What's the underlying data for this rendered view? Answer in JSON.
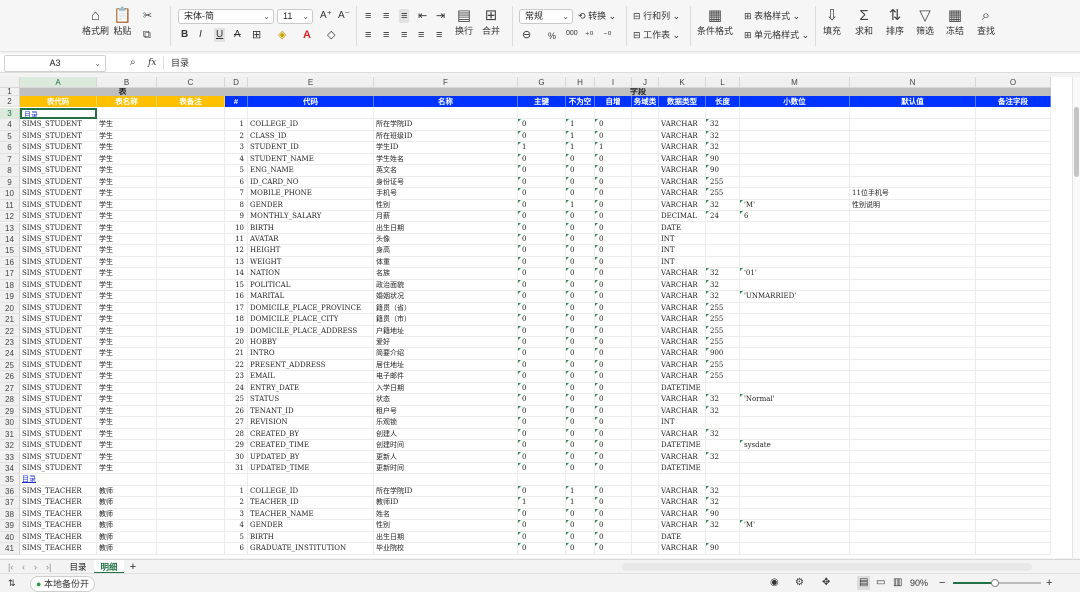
{
  "toolbar": {
    "format_painter": "格式刷",
    "paste": "粘贴",
    "font_name": "宋体-简",
    "font_size": "11",
    "wrap": "换行",
    "merge": "合并",
    "number_format": "常规",
    "convert": "转换",
    "rows_cols": "行和列",
    "worksheet": "工作表",
    "cond_format": "条件格式",
    "table_style": "表格样式",
    "cell_style": "单元格样式",
    "fill": "填充",
    "sum": "求和",
    "sort": "排序",
    "filter": "筛选",
    "freeze": "冻结",
    "find": "查找",
    "percent": "%",
    "thousands": "000"
  },
  "formula_bar": {
    "cell_ref": "A3",
    "fx": "fx",
    "value": "目录"
  },
  "columns": [
    "A",
    "B",
    "C",
    "D",
    "E",
    "F",
    "G",
    "H",
    "I",
    "J",
    "K",
    "L",
    "M",
    "N",
    "O"
  ],
  "group_headers": {
    "table": "表",
    "fields": "字段"
  },
  "headers": {
    "table_code": "表代码",
    "table_name": "表名称",
    "table_note": "表备注",
    "idx": "#",
    "code": "代码",
    "name": "名称",
    "pk": "主键",
    "notnull": "不为空",
    "autoinc": "自增",
    "biz": "务域类",
    "dtype": "数据类型",
    "len": "长度",
    "dec": "小数位",
    "default": "默认值",
    "note": "备注字段"
  },
  "rows": [
    [
      "3",
      "目录",
      "",
      "",
      "",
      "",
      "",
      "",
      "",
      "",
      "",
      "",
      "",
      "",
      ""
    ],
    [
      "4",
      "SIMS_STUDENT",
      "学生",
      "",
      "1",
      "COLLEGE_ID",
      "所在学院ID",
      "0",
      "1",
      "0",
      "",
      "VARCHAR",
      "32",
      "",
      ""
    ],
    [
      "5",
      "SIMS_STUDENT",
      "学生",
      "",
      "2",
      "CLASS_ID",
      "所在班级ID",
      "0",
      "1",
      "0",
      "",
      "VARCHAR",
      "32",
      "",
      ""
    ],
    [
      "6",
      "SIMS_STUDENT",
      "学生",
      "",
      "3",
      "STUDENT_ID",
      "学生ID",
      "1",
      "1",
      "1",
      "",
      "VARCHAR",
      "32",
      "",
      ""
    ],
    [
      "7",
      "SIMS_STUDENT",
      "学生",
      "",
      "4",
      "STUDENT_NAME",
      "学生姓名",
      "0",
      "0",
      "0",
      "",
      "VARCHAR",
      "90",
      "",
      ""
    ],
    [
      "8",
      "SIMS_STUDENT",
      "学生",
      "",
      "5",
      "ENG_NAME",
      "英文名",
      "0",
      "0",
      "0",
      "",
      "VARCHAR",
      "90",
      "",
      ""
    ],
    [
      "9",
      "SIMS_STUDENT",
      "学生",
      "",
      "6",
      "ID_CARD_NO",
      "身份证号",
      "0",
      "0",
      "0",
      "",
      "VARCHAR",
      "255",
      "",
      ""
    ],
    [
      "10",
      "SIMS_STUDENT",
      "学生",
      "",
      "7",
      "MOBILE_PHONE",
      "手机号",
      "0",
      "0",
      "0",
      "",
      "VARCHAR",
      "255",
      "",
      "11位手机号"
    ],
    [
      "11",
      "SIMS_STUDENT",
      "学生",
      "",
      "8",
      "GENDER",
      "性别",
      "0",
      "1",
      "0",
      "",
      "VARCHAR",
      "32",
      "'M'",
      "性别说明"
    ],
    [
      "12",
      "SIMS_STUDENT",
      "学生",
      "",
      "9",
      "MONTHLY_SALARY",
      "月薪",
      "0",
      "0",
      "0",
      "",
      "DECIMAL",
      "24",
      "6",
      ""
    ],
    [
      "13",
      "SIMS_STUDENT",
      "学生",
      "",
      "10",
      "BIRTH",
      "出生日期",
      "0",
      "0",
      "0",
      "",
      "DATE",
      "",
      "",
      ""
    ],
    [
      "14",
      "SIMS_STUDENT",
      "学生",
      "",
      "11",
      "AVATAR",
      "头像",
      "0",
      "0",
      "0",
      "",
      "INT",
      "",
      "",
      ""
    ],
    [
      "15",
      "SIMS_STUDENT",
      "学生",
      "",
      "12",
      "HEIGHT",
      "身高",
      "0",
      "0",
      "0",
      "",
      "INT",
      "",
      "",
      ""
    ],
    [
      "16",
      "SIMS_STUDENT",
      "学生",
      "",
      "13",
      "WEIGHT",
      "体重",
      "0",
      "0",
      "0",
      "",
      "INT",
      "",
      "",
      ""
    ],
    [
      "17",
      "SIMS_STUDENT",
      "学生",
      "",
      "14",
      "NATION",
      "名族",
      "0",
      "0",
      "0",
      "",
      "VARCHAR",
      "32",
      "'01'",
      ""
    ],
    [
      "18",
      "SIMS_STUDENT",
      "学生",
      "",
      "15",
      "POLITICAL",
      "政治面貌",
      "0",
      "0",
      "0",
      "",
      "VARCHAR",
      "32",
      "",
      ""
    ],
    [
      "19",
      "SIMS_STUDENT",
      "学生",
      "",
      "16",
      "MARITAL",
      "婚姻状况",
      "0",
      "0",
      "0",
      "",
      "VARCHAR",
      "32",
      "'UNMARRIED'",
      ""
    ],
    [
      "20",
      "SIMS_STUDENT",
      "学生",
      "",
      "17",
      "DOMICILE_PLACE_PROVINCE",
      "籍贯（省）",
      "0",
      "0",
      "0",
      "",
      "VARCHAR",
      "255",
      "",
      ""
    ],
    [
      "21",
      "SIMS_STUDENT",
      "学生",
      "",
      "18",
      "DOMICILE_PLACE_CITY",
      "籍贯（市）",
      "0",
      "0",
      "0",
      "",
      "VARCHAR",
      "255",
      "",
      ""
    ],
    [
      "22",
      "SIMS_STUDENT",
      "学生",
      "",
      "19",
      "DOMICILE_PLACE_ADDRESS",
      "户籍地址",
      "0",
      "0",
      "0",
      "",
      "VARCHAR",
      "255",
      "",
      ""
    ],
    [
      "23",
      "SIMS_STUDENT",
      "学生",
      "",
      "20",
      "HOBBY",
      "爱好",
      "0",
      "0",
      "0",
      "",
      "VARCHAR",
      "255",
      "",
      ""
    ],
    [
      "24",
      "SIMS_STUDENT",
      "学生",
      "",
      "21",
      "INTRO",
      "简要介绍",
      "0",
      "0",
      "0",
      "",
      "VARCHAR",
      "900",
      "",
      ""
    ],
    [
      "25",
      "SIMS_STUDENT",
      "学生",
      "",
      "22",
      "PRESENT_ADDRESS",
      "居住地址",
      "0",
      "0",
      "0",
      "",
      "VARCHAR",
      "255",
      "",
      ""
    ],
    [
      "26",
      "SIMS_STUDENT",
      "学生",
      "",
      "23",
      "EMAIL",
      "电子邮件",
      "0",
      "0",
      "0",
      "",
      "VARCHAR",
      "255",
      "",
      ""
    ],
    [
      "27",
      "SIMS_STUDENT",
      "学生",
      "",
      "24",
      "ENTRY_DATE",
      "入学日期",
      "0",
      "0",
      "0",
      "",
      "DATETIME",
      "",
      "",
      ""
    ],
    [
      "28",
      "SIMS_STUDENT",
      "学生",
      "",
      "25",
      "STATUS",
      "状态",
      "0",
      "0",
      "0",
      "",
      "VARCHAR",
      "32",
      "'Normal'",
      ""
    ],
    [
      "29",
      "SIMS_STUDENT",
      "学生",
      "",
      "26",
      "TENANT_ID",
      "租户号",
      "0",
      "0",
      "0",
      "",
      "VARCHAR",
      "32",
      "",
      ""
    ],
    [
      "30",
      "SIMS_STUDENT",
      "学生",
      "",
      "27",
      "REVISION",
      "乐观锁",
      "0",
      "0",
      "0",
      "",
      "INT",
      "",
      "",
      ""
    ],
    [
      "31",
      "SIMS_STUDENT",
      "学生",
      "",
      "28",
      "CREATED_BY",
      "创建人",
      "0",
      "0",
      "0",
      "",
      "VARCHAR",
      "32",
      "",
      ""
    ],
    [
      "32",
      "SIMS_STUDENT",
      "学生",
      "",
      "29",
      "CREATED_TIME",
      "创建时间",
      "0",
      "0",
      "0",
      "",
      "DATETIME",
      "",
      "sysdate",
      ""
    ],
    [
      "33",
      "SIMS_STUDENT",
      "学生",
      "",
      "30",
      "UPDATED_BY",
      "更新人",
      "0",
      "0",
      "0",
      "",
      "VARCHAR",
      "32",
      "",
      ""
    ],
    [
      "34",
      "SIMS_STUDENT",
      "学生",
      "",
      "31",
      "UPDATED_TIME",
      "更新时间",
      "0",
      "0",
      "0",
      "",
      "DATETIME",
      "",
      "",
      ""
    ],
    [
      "35",
      "目录",
      "",
      "",
      "",
      "",
      "",
      "",
      "",
      "",
      "",
      "",
      "",
      "",
      ""
    ],
    [
      "36",
      "SIMS_TEACHER",
      "教师",
      "",
      "1",
      "COLLEGE_ID",
      "所在学院ID",
      "0",
      "1",
      "0",
      "",
      "VARCHAR",
      "32",
      "",
      ""
    ],
    [
      "37",
      "SIMS_TEACHER",
      "教师",
      "",
      "2",
      "TEACHER_ID",
      "教师ID",
      "1",
      "1",
      "0",
      "",
      "VARCHAR",
      "32",
      "",
      ""
    ],
    [
      "38",
      "SIMS_TEACHER",
      "教师",
      "",
      "3",
      "TEACHER_NAME",
      "姓名",
      "0",
      "0",
      "0",
      "",
      "VARCHAR",
      "90",
      "",
      ""
    ],
    [
      "39",
      "SIMS_TEACHER",
      "教师",
      "",
      "4",
      "GENDER",
      "性别",
      "0",
      "0",
      "0",
      "",
      "VARCHAR",
      "32",
      "'M'",
      ""
    ],
    [
      "40",
      "SIMS_TEACHER",
      "教师",
      "",
      "5",
      "BIRTH",
      "出生日期",
      "0",
      "0",
      "0",
      "",
      "DATE",
      "",
      "",
      ""
    ],
    [
      "41",
      "SIMS_TEACHER",
      "教师",
      "",
      "6",
      "GRADUATE_INSTITUTION",
      "毕业院校",
      "0",
      "0",
      "0",
      "",
      "VARCHAR",
      "90",
      "",
      ""
    ]
  ],
  "sheets": [
    {
      "name": "目录",
      "active": false
    },
    {
      "name": "明细",
      "active": true
    }
  ],
  "add_sheet": "+",
  "status": {
    "backup": "本地备份开",
    "zoom": "90%",
    "zoom_level": 0.48
  },
  "colors": {
    "accent": "#217346",
    "header_blue": "#0033ff",
    "header_yellow": "#ffc000",
    "group_gray": "#bfbfbf",
    "link_blue": "#1a33cc"
  }
}
